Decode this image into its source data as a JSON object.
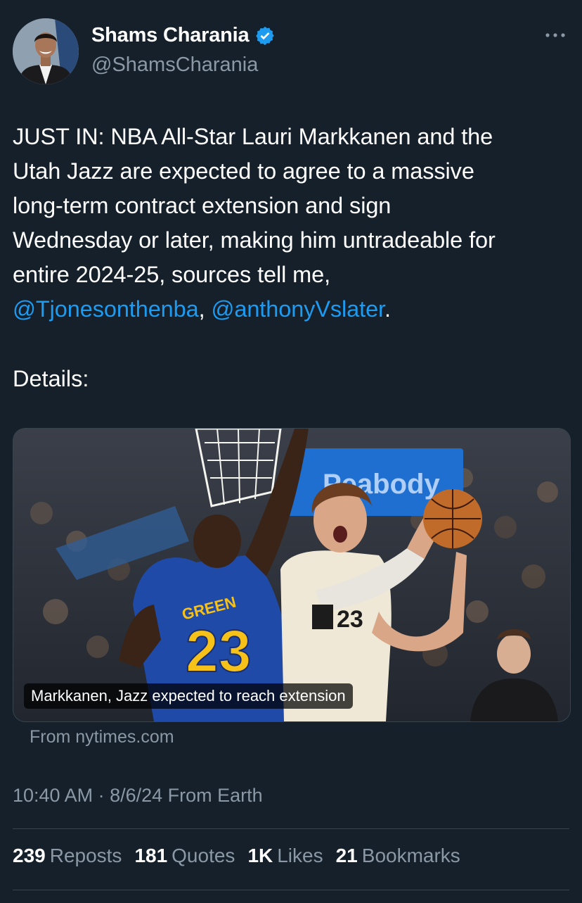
{
  "author": {
    "name": "Shams Charania",
    "handle": "@ShamsCharania",
    "verified_color": "#1d9bf0"
  },
  "more_icon": "more-horizontal-icon",
  "tweet": {
    "lines": [
      "JUST IN: NBA All-Star Lauri Markkanen and the",
      "Utah Jazz are expected to agree to a massive",
      "long-term contract extension and sign",
      "Wednesday or later, making him untradeable for",
      "entire 2024-25, sources tell me,"
    ],
    "mention1": "@Tjonesonthenba",
    "separator": ", ",
    "mention2": "@anthonyVslater",
    "end": ".",
    "details": "Details:"
  },
  "card": {
    "caption": "Markkanen, Jazz expected to reach extension",
    "source": "From nytimes.com",
    "image_text": {
      "jersey_name": "GREEN",
      "jersey_number": "23",
      "jazz_number": "23",
      "banner": "Peabody"
    }
  },
  "meta": {
    "time": "10:40 AM",
    "dot": " · ",
    "date": "8/6/24",
    "location": " From Earth"
  },
  "stats": {
    "reposts": {
      "count": "239",
      "label": "Reposts"
    },
    "quotes": {
      "count": "181",
      "label": "Quotes"
    },
    "likes": {
      "count": "1K",
      "label": "Likes"
    },
    "bookmarks": {
      "count": "21",
      "label": "Bookmarks"
    }
  },
  "colors": {
    "background": "#15202b",
    "text": "#ffffff",
    "secondary": "#8b98a5",
    "link": "#1d9bf0",
    "border": "#38444d"
  }
}
